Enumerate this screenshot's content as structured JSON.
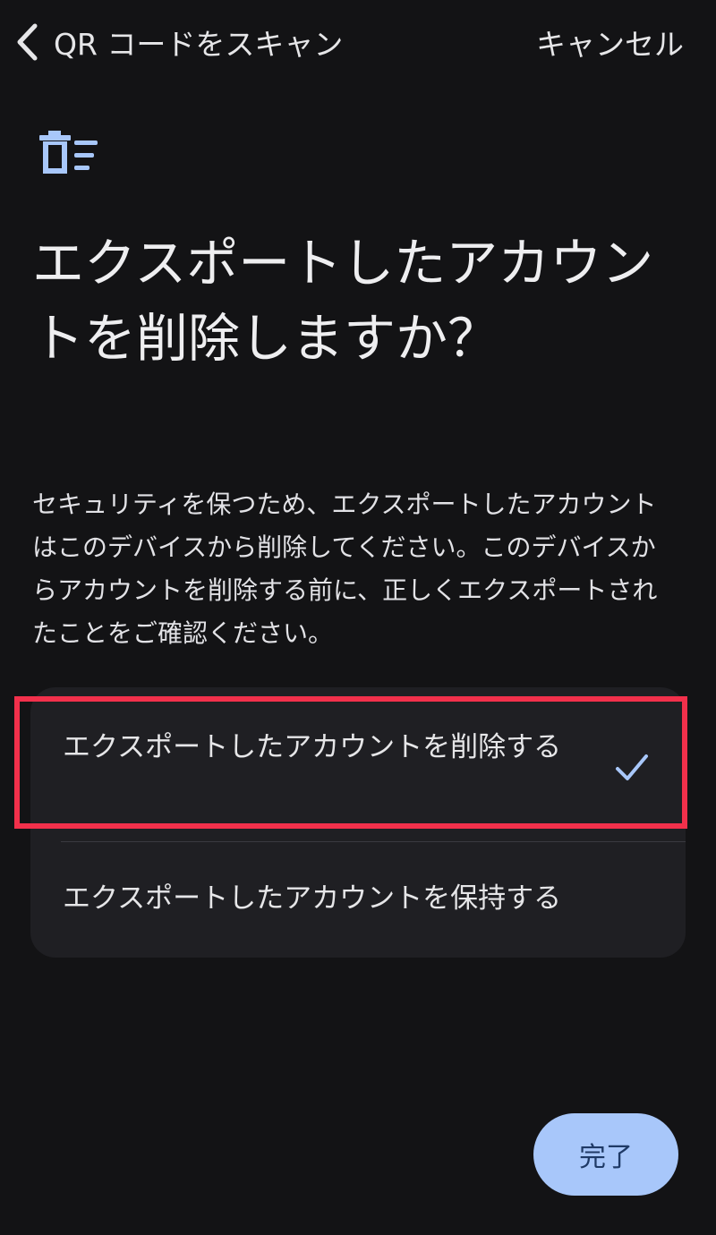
{
  "topbar": {
    "back_label": "QR コードをスキャン",
    "cancel_label": "キャンセル"
  },
  "header_icon": "delete-list-icon",
  "title": "エクスポートしたアカウントを削除しますか？",
  "description": "セキュリティを保つため、エクスポートしたアカウントはこのデバイスから削除してください。このデバイスからアカウントを削除する前に、正しくエクスポートされたことをご確認ください。",
  "options": [
    {
      "label": "エクスポートしたアカウントを削除する",
      "selected": true,
      "icon": "check-icon"
    },
    {
      "label": "エクスポートしたアカウントを保持する",
      "selected": false
    }
  ],
  "done_label": "完了",
  "colors": {
    "background": "#131315",
    "card": "#1f1f23",
    "accent": "#a8c7fa",
    "highlight": "#f2304b"
  }
}
